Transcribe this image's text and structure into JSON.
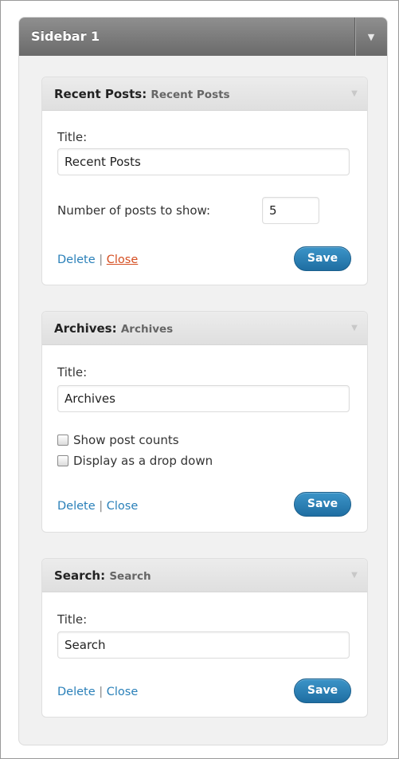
{
  "sidebar": {
    "title": "Sidebar 1",
    "toggle_icon": "triangle-down-icon"
  },
  "widgets": [
    {
      "name": "Recent Posts",
      "instance_title": "Recent Posts",
      "title_label": "Title:",
      "title_value": "Recent Posts",
      "number_label": "Number of posts to show:",
      "number_value": "5",
      "delete_label": "Delete",
      "separator": "|",
      "close_label": "Close",
      "save_label": "Save"
    },
    {
      "name": "Archives",
      "instance_title": "Archives",
      "title_label": "Title:",
      "title_value": "Archives",
      "checkboxes": [
        {
          "label": "Show post counts",
          "checked": false
        },
        {
          "label": "Display as a drop down",
          "checked": false
        }
      ],
      "delete_label": "Delete",
      "separator": "|",
      "close_label": "Close",
      "save_label": "Save"
    },
    {
      "name": "Search",
      "instance_title": "Search",
      "title_label": "Title:",
      "title_value": "Search",
      "delete_label": "Delete",
      "separator": "|",
      "close_label": "Close",
      "save_label": "Save"
    }
  ],
  "colors": {
    "link": "#2a80b9",
    "link_active": "#d54e21",
    "save_button": "#2a7ab0",
    "sidebar_header": "#7b7b7b"
  }
}
